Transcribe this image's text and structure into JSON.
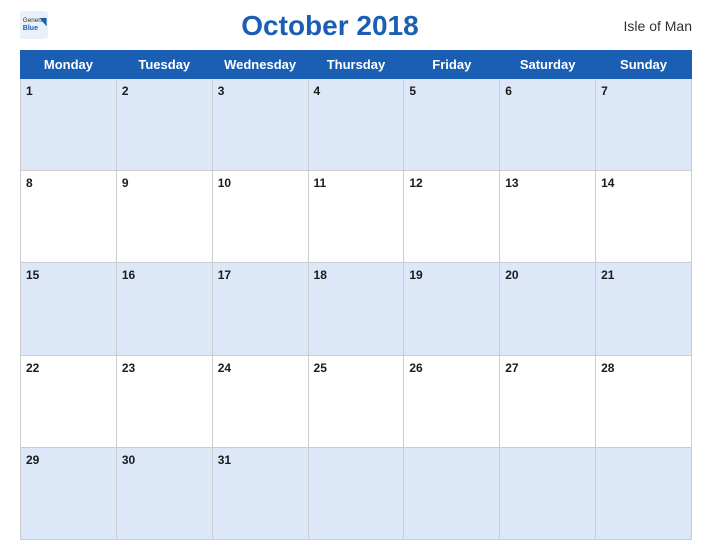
{
  "header": {
    "logo_general": "General",
    "logo_blue": "Blue",
    "title": "October 2018",
    "region": "Isle of Man"
  },
  "calendar": {
    "days_of_week": [
      "Monday",
      "Tuesday",
      "Wednesday",
      "Thursday",
      "Friday",
      "Saturday",
      "Sunday"
    ],
    "weeks": [
      [
        1,
        2,
        3,
        4,
        5,
        6,
        7
      ],
      [
        8,
        9,
        10,
        11,
        12,
        13,
        14
      ],
      [
        15,
        16,
        17,
        18,
        19,
        20,
        21
      ],
      [
        22,
        23,
        24,
        25,
        26,
        27,
        28
      ],
      [
        29,
        30,
        31,
        null,
        null,
        null,
        null
      ]
    ]
  }
}
